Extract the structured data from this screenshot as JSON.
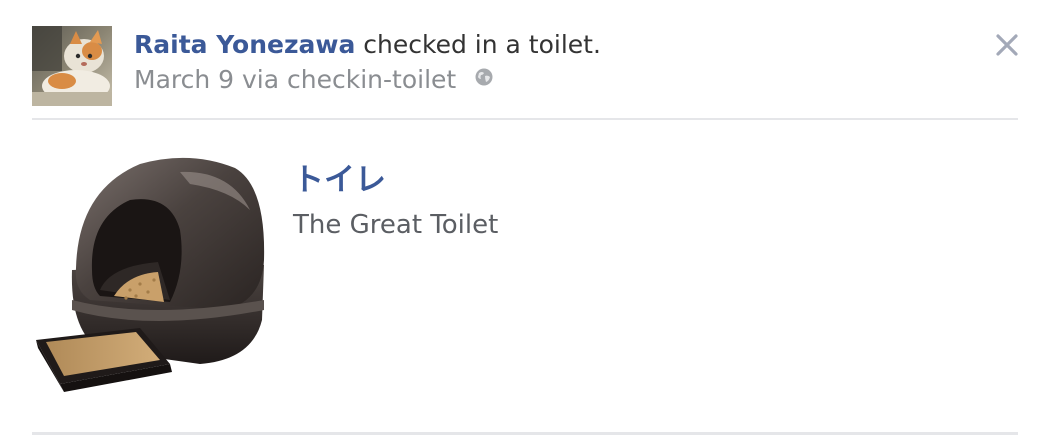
{
  "story": {
    "author": "Raita Yonezawa",
    "action_text": " checked in a toilet.",
    "date": "March 9",
    "via_prefix": " via ",
    "app_name": "checkin-toilet",
    "privacy_icon": "globe-icon",
    "close_icon": "close-icon",
    "close_glyph": "✕"
  },
  "attachment": {
    "place_name": "トイレ",
    "place_description": "The Great Toilet",
    "image_icon": "toilet-image"
  },
  "colors": {
    "link": "#3b5998",
    "text": "#333333",
    "meta": "#8a8d91",
    "divider": "#e5e6e9"
  }
}
